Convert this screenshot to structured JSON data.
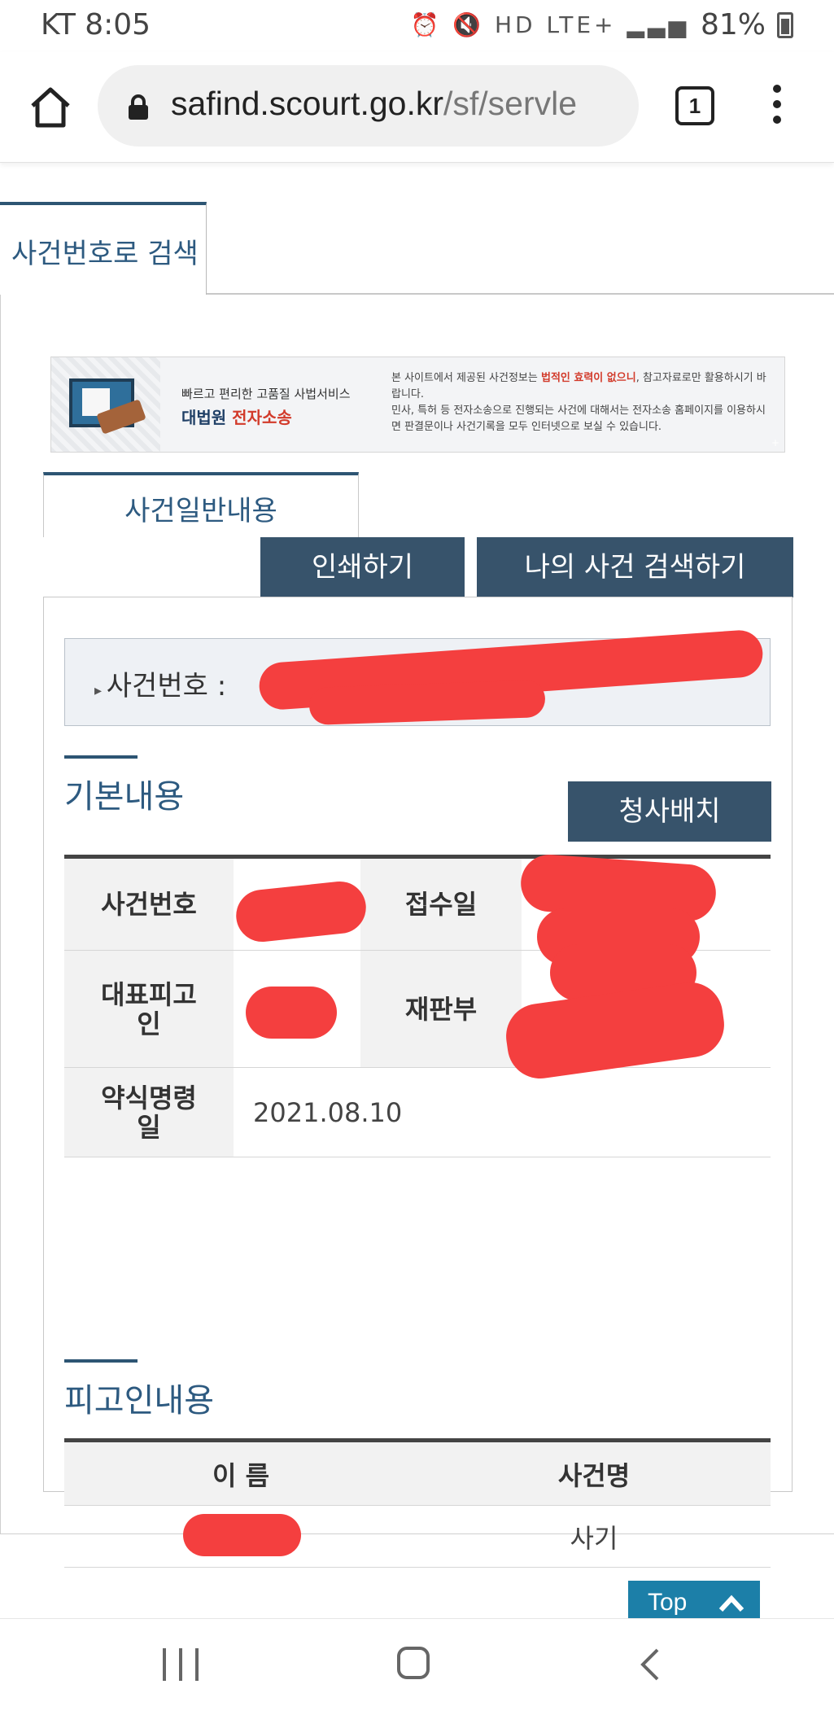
{
  "status_bar": {
    "carrier_time": "KT 8:05",
    "icons": "⏰ 🔇 HD LTE+ ▂▃▅",
    "battery": "81%"
  },
  "browser": {
    "url_host": "safind.scourt.go.kr",
    "url_path": "/sf/servle",
    "tab_count": "1"
  },
  "page": {
    "outer_tab": "사건번호로 검색",
    "banner": {
      "subtitle": "빠르고 편리한 고품질 사법서비스",
      "title_prefix": "대법원 ",
      "title_highlight": "전자소송",
      "notice_1": "본 사이트에서 제공된 사건정보는 ",
      "notice_highlight": "법적인 효력이 없으니",
      "notice_2": ", 참고자료로만 활용하시기 바랍니다.",
      "notice_3": "민사, 특허 등 전자소송으로 진행되는 사건에 대해서는 전자소송 홈페이지를 이용하시면 판결문이나 사건기록을 모두 인터넷으로 보실 수 있습니다.",
      "plus": "+"
    },
    "inner_tab": "사건일반내용",
    "print_button": "인쇄하기",
    "my_case_button": "나의 사건 검색하기",
    "case_number_label": "사건번호 : ",
    "basic_section_title": "기본내용",
    "courthouse_button": "청사배치",
    "basic_table": {
      "case_number_header": "사건번호",
      "case_number_value": "",
      "receipt_date_header": "접수일",
      "receipt_date_value": "",
      "defendant_header": "대표피고인",
      "defendant_header_line1": "대표피고",
      "defendant_header_line2": "인",
      "defendant_value": "",
      "court_division_header": "재판부",
      "court_division_value": "",
      "summary_order_header_line1": "약식명령",
      "summary_order_header_line2": "일",
      "summary_order_value": "2021.08.10"
    },
    "defendant_section_title": "피고인내용",
    "defendant_table": {
      "name_header": "이 름",
      "case_name_header": "사건명",
      "rows": [
        {
          "name": "",
          "case_name": "사기"
        }
      ]
    },
    "top_button": "Top"
  },
  "colors": {
    "accent": "#37536b",
    "title_blue": "#2d5a80",
    "top_button": "#1c7fa8",
    "redaction": "#f43f3f"
  }
}
